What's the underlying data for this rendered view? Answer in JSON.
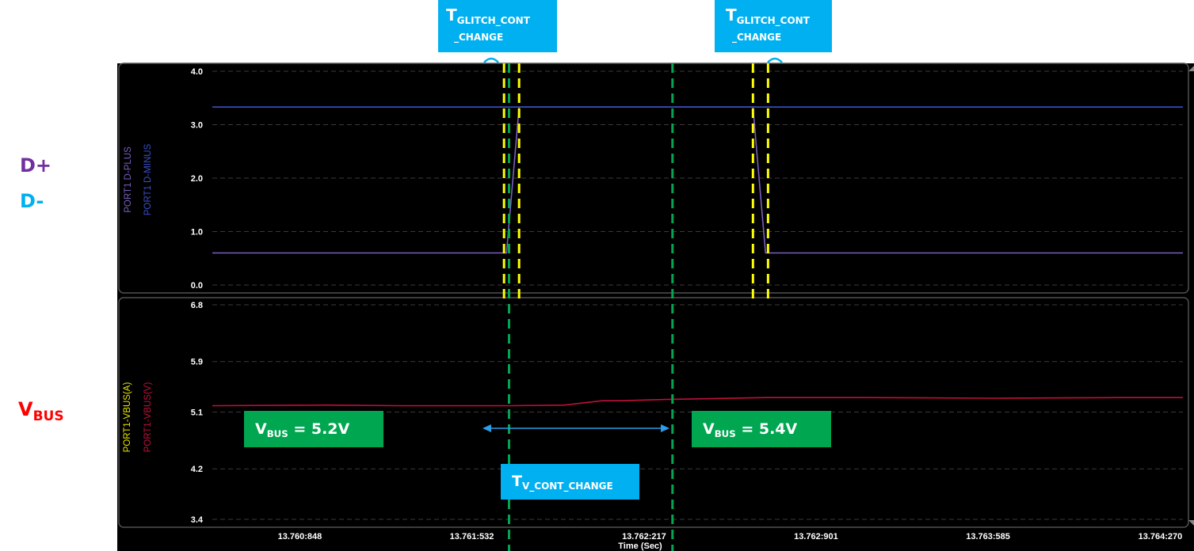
{
  "side_labels": {
    "dplus": "D+",
    "dminus": "D-",
    "vbus_main": "V",
    "vbus_sub": "BUS"
  },
  "annotations": {
    "glitch_left": {
      "t": "T",
      "sub1": "GLITCH_CONT",
      "sub2": "_CHANGE"
    },
    "glitch_right": {
      "t": "T",
      "sub1": "GLITCH_CONT",
      "sub2": "_CHANGE"
    },
    "vbus_before": {
      "v": "V",
      "sub": "BUS",
      "value": " = 5.2V"
    },
    "vbus_after": {
      "v": "V",
      "sub": "BUS",
      "value": " = 5.4V"
    },
    "tv_cont": {
      "t": "T",
      "sub": "V_CONT_CHANGE"
    }
  },
  "colors": {
    "background": "#000000",
    "dplus": "#7b5fc0",
    "dminus": "#3a50c8",
    "vbus_v": "#c0103a",
    "vbus_a": "#e6e600",
    "green_box": "#00a650",
    "blue_box": "#00b0f0",
    "guide_yellow": "#ffff00",
    "guide_green": "#00a650",
    "label_purple": "#7030a0",
    "label_cyan": "#00b0f0",
    "label_red": "#ff0000"
  },
  "chart_data": {
    "type": "line",
    "x_axis": {
      "label": "Time (Sec)",
      "range": [
        13.7605,
        13.76436
      ],
      "ticks": [
        13.760848,
        13.761532,
        13.762217,
        13.762901,
        13.763585,
        13.76427
      ],
      "tick_labels": [
        "13.760:848",
        "13.761:532",
        "13.762:217",
        "13.762:901",
        "13.763:585",
        "13.764:270"
      ]
    },
    "panels": [
      {
        "ylim": [
          0.0,
          4.0
        ],
        "yticks": [
          0.0,
          1.0,
          2.0,
          3.0,
          4.0
        ],
        "ytick_labels": [
          "0.0",
          "1.0",
          "2.0",
          "3.0",
          "4.0"
        ],
        "legend": [
          "PORT1 D-PLUS",
          "PORT1 D-MINUS"
        ],
        "series": [
          {
            "name": "PORT1 D-PLUS",
            "x": [
              13.7605,
              13.76167,
              13.76172,
              13.76265,
              13.7627,
              13.76436
            ],
            "y": [
              0.6,
              0.6,
              3.33,
              3.33,
              0.6,
              0.6
            ]
          },
          {
            "name": "PORT1 D-MINUS",
            "x": [
              13.7605,
              13.76436
            ],
            "y": [
              3.33,
              3.33
            ]
          }
        ]
      },
      {
        "ylim": [
          3.4,
          6.8
        ],
        "yticks": [
          3.4,
          4.2,
          5.1,
          5.9,
          6.8
        ],
        "ytick_labels": [
          "3.4",
          "4.2",
          "5.1",
          "5.9",
          "6.8"
        ],
        "legend": [
          "PORT1-VBUS(A)",
          "PORT1-VBUS(V)"
        ],
        "series": [
          {
            "name": "PORT1-VBUS(V)",
            "x": [
              13.7605,
              13.76095,
              13.76125,
              13.76168,
              13.7619,
              13.76205,
              13.76212,
              13.7623,
              13.7627,
              13.7631,
              13.7636,
              13.7641,
              13.76436
            ],
            "y": [
              5.2,
              5.21,
              5.2,
              5.2,
              5.21,
              5.28,
              5.28,
              5.3,
              5.33,
              5.33,
              5.32,
              5.33,
              5.33
            ]
          }
        ]
      }
    ],
    "markers": {
      "yellow_dashed_x": [
        13.76166,
        13.76172,
        13.76265,
        13.76271
      ],
      "green_dashed_x": [
        13.76168,
        13.76233
      ]
    }
  }
}
